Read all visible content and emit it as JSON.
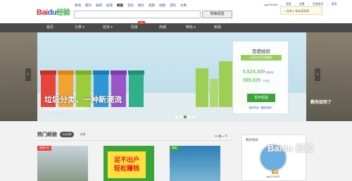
{
  "header": {
    "logo": {
      "left": "Bai",
      "paw": "du",
      "right": "经验"
    },
    "nav_links": [
      "新闻",
      "网页",
      "贴吧",
      "知道",
      "经验",
      "音乐",
      "图片",
      "视频",
      "地图",
      "百科",
      "文库"
    ],
    "current_link": "经验",
    "search": {
      "value": "",
      "placeholder": ""
    },
    "search_button": "搜索经验",
    "user": {
      "name": "cgc201902",
      "messages": "消息",
      "settings": "设置",
      "home": "百度首页",
      "more": "更多"
    },
    "dropdown": {
      "check": "✓",
      "text": "没有 2 条未读消息"
    }
  },
  "nav": {
    "items": [
      {
        "label": "首页"
      },
      {
        "label": "分类 ▾"
      },
      {
        "label": "任务 ▾"
      },
      {
        "label": "回享",
        "badge": "new"
      },
      {
        "label": "商城"
      },
      {
        "label": "特色 ▾"
      },
      {
        "label": "知道"
      }
    ]
  },
  "banner": {
    "title": "垃圾分类，一种新潮流",
    "subtitle": "你的垃圾分类吗？还未爆裂吧",
    "author": "作者：晨晨的新家",
    "left_arrow": "‹",
    "right_arrow": "›",
    "right_side_text": "教你如何了",
    "dots": [
      false,
      false,
      true,
      false,
      false
    ]
  },
  "card": {
    "title": "百度经验",
    "ribbon": "分享让生活更美好",
    "experiences": "6,524,309",
    "experiences_unit": "篇经验",
    "users": "569,026",
    "users_unit": "个作者",
    "publish_button": "发布经验",
    "link": "如何写出一篇好经验？"
  },
  "hot": {
    "title": "热门经验",
    "tabs": [
      {
        "label": "24小时"
      },
      {
        "label": "本周"
      }
    ],
    "refresh": "换一下",
    "items": [
      {
        "tag": "旅游户外"
      },
      {
        "tag": "",
        "headline1": "足不出户",
        "headline2": "轻松赚钱"
      },
      {
        "tag": "情感"
      }
    ]
  },
  "mypanel": {
    "title": "我的经验",
    "level": "1级",
    "username": "cgc201902"
  },
  "watermark": "Baidu 经验",
  "colors": {
    "accent": "#3aa43a",
    "nav_bg": "#4a4a4a",
    "logo_red": "#dd2222",
    "link": "#2b4fa3"
  }
}
